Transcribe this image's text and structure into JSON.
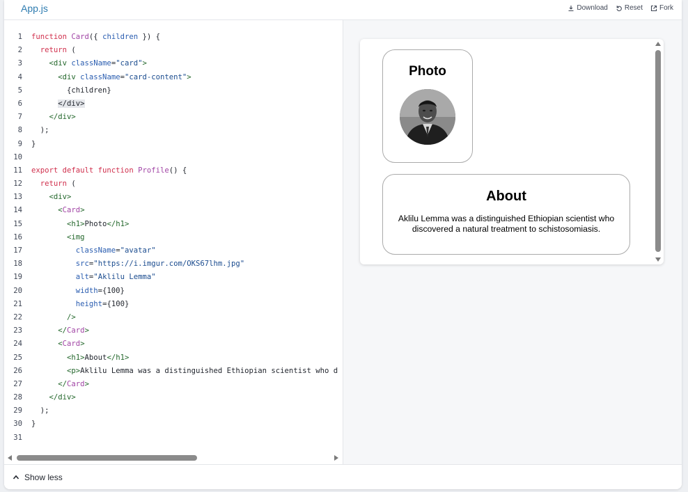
{
  "header": {
    "tab_label": "App.js",
    "actions": {
      "download": "Download",
      "reset": "Reset",
      "fork": "Fork"
    }
  },
  "editor": {
    "lines": [
      [
        [
          "k",
          "function "
        ],
        [
          "f",
          "Card"
        ],
        [
          "",
          "({ "
        ],
        [
          "a",
          "children"
        ],
        [
          "",
          " }) {"
        ]
      ],
      [
        [
          "",
          "  "
        ],
        [
          "k",
          "return"
        ],
        [
          "",
          " ("
        ]
      ],
      [
        [
          "",
          "    "
        ],
        [
          "t",
          "<div "
        ],
        [
          "a",
          "className"
        ],
        [
          "",
          "="
        ],
        [
          "s",
          "\"card\""
        ],
        [
          "t",
          ">"
        ]
      ],
      [
        [
          "",
          "      "
        ],
        [
          "t",
          "<div "
        ],
        [
          "a",
          "className"
        ],
        [
          "",
          "="
        ],
        [
          "s",
          "\"card-content\""
        ],
        [
          "t",
          ">"
        ]
      ],
      [
        [
          "",
          "        {children}"
        ]
      ],
      [
        [
          "",
          "      "
        ],
        [
          "hl",
          "</div>"
        ]
      ],
      [
        [
          "",
          "    "
        ],
        [
          "t",
          "</div>"
        ]
      ],
      [
        [
          "",
          "  );"
        ]
      ],
      [
        [
          "",
          "}"
        ]
      ],
      [],
      [
        [
          "k",
          "export default function "
        ],
        [
          "f",
          "Profile"
        ],
        [
          "",
          "() {"
        ]
      ],
      [
        [
          "",
          "  "
        ],
        [
          "k",
          "return"
        ],
        [
          "",
          " ("
        ]
      ],
      [
        [
          "",
          "    "
        ],
        [
          "t",
          "<div>"
        ]
      ],
      [
        [
          "",
          "      "
        ],
        [
          "t",
          "<"
        ],
        [
          "f",
          "Card"
        ],
        [
          "t",
          ">"
        ]
      ],
      [
        [
          "",
          "        "
        ],
        [
          "t",
          "<h1>"
        ],
        [
          "",
          "Photo"
        ],
        [
          "t",
          "</h1>"
        ]
      ],
      [
        [
          "",
          "        "
        ],
        [
          "t",
          "<img"
        ]
      ],
      [
        [
          "",
          "          "
        ],
        [
          "a",
          "className"
        ],
        [
          "",
          "="
        ],
        [
          "s",
          "\"avatar\""
        ]
      ],
      [
        [
          "",
          "          "
        ],
        [
          "a",
          "src"
        ],
        [
          "",
          "="
        ],
        [
          "s",
          "\"https://i.imgur.com/OKS67lhm.jpg\""
        ]
      ],
      [
        [
          "",
          "          "
        ],
        [
          "a",
          "alt"
        ],
        [
          "",
          "="
        ],
        [
          "s",
          "\"Aklilu Lemma\""
        ]
      ],
      [
        [
          "",
          "          "
        ],
        [
          "a",
          "width"
        ],
        [
          "",
          "={100}"
        ]
      ],
      [
        [
          "",
          "          "
        ],
        [
          "a",
          "height"
        ],
        [
          "",
          "={100}"
        ]
      ],
      [
        [
          "",
          "        "
        ],
        [
          "t",
          "/>"
        ]
      ],
      [
        [
          "",
          "      "
        ],
        [
          "t",
          "</"
        ],
        [
          "f",
          "Card"
        ],
        [
          "t",
          ">"
        ]
      ],
      [
        [
          "",
          "      "
        ],
        [
          "t",
          "<"
        ],
        [
          "f",
          "Card"
        ],
        [
          "t",
          ">"
        ]
      ],
      [
        [
          "",
          "        "
        ],
        [
          "t",
          "<h1>"
        ],
        [
          "",
          "About"
        ],
        [
          "t",
          "</h1>"
        ]
      ],
      [
        [
          "",
          "        "
        ],
        [
          "t",
          "<p>"
        ],
        [
          "",
          "Aklilu Lemma was a distinguished Ethiopian scientist who d"
        ]
      ],
      [
        [
          "",
          "      "
        ],
        [
          "t",
          "</"
        ],
        [
          "f",
          "Card"
        ],
        [
          "t",
          ">"
        ]
      ],
      [
        [
          "",
          "    "
        ],
        [
          "t",
          "</div>"
        ]
      ],
      [
        [
          "",
          "  );"
        ]
      ],
      [
        [
          "",
          "}"
        ]
      ],
      []
    ]
  },
  "preview": {
    "photo_card": {
      "title": "Photo",
      "avatar_alt": "Aklilu Lemma"
    },
    "about_card": {
      "title": "About",
      "text": "Aklilu Lemma was a distinguished Ethiopian scientist who discovered a natural treatment to schistosomiasis."
    }
  },
  "footer": {
    "toggle_label": "Show less"
  },
  "colors": {
    "accent": "#2e7cb0",
    "keyword": "#d0304d",
    "component": "#a145a5",
    "tag": "#23672b",
    "attribute": "#2a5db0",
    "string": "#1b4c8f"
  }
}
